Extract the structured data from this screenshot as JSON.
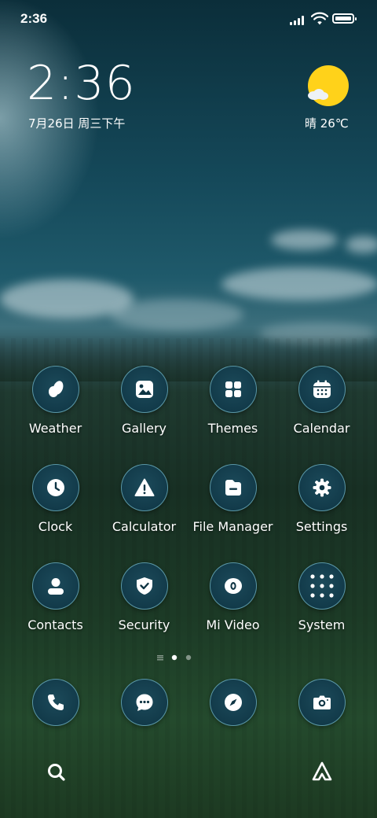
{
  "status_bar": {
    "time": "2:36"
  },
  "clock_widget": {
    "time": "2:36",
    "date": "7月26日 周三下午"
  },
  "weather_widget": {
    "text": "晴 26℃",
    "icon": "sun-with-cloud-icon"
  },
  "apps": [
    {
      "label": "Weather",
      "icon": "weather-drop-icon"
    },
    {
      "label": "Gallery",
      "icon": "image-icon"
    },
    {
      "label": "Themes",
      "icon": "grid-squares-icon"
    },
    {
      "label": "Calendar",
      "icon": "calendar-icon"
    },
    {
      "label": "Clock",
      "icon": "clock-icon"
    },
    {
      "label": "Calculator",
      "icon": "warning-triangle-icon"
    },
    {
      "label": "File Manager",
      "icon": "folder-icon"
    },
    {
      "label": "Settings",
      "icon": "gear-icon"
    },
    {
      "label": "Contacts",
      "icon": "person-icon"
    },
    {
      "label": "Security",
      "icon": "shield-check-icon"
    },
    {
      "label": "Mi Video",
      "icon": "video-ring-icon"
    },
    {
      "label": "System",
      "icon": "folder-grid-icon"
    }
  ],
  "dock": [
    {
      "icon": "phone-icon"
    },
    {
      "icon": "message-bubble-icon"
    },
    {
      "icon": "compass-icon"
    },
    {
      "icon": "camera-icon"
    }
  ],
  "page_indicator": {
    "current": 1,
    "total": 2
  },
  "bottom_bar": {
    "left_icon": "search-icon",
    "right_icon": "launcher-logo-icon"
  },
  "colors": {
    "icon_fill": "#0e3443",
    "icon_ring": "#78bec8",
    "sun": "#ffd21a"
  }
}
